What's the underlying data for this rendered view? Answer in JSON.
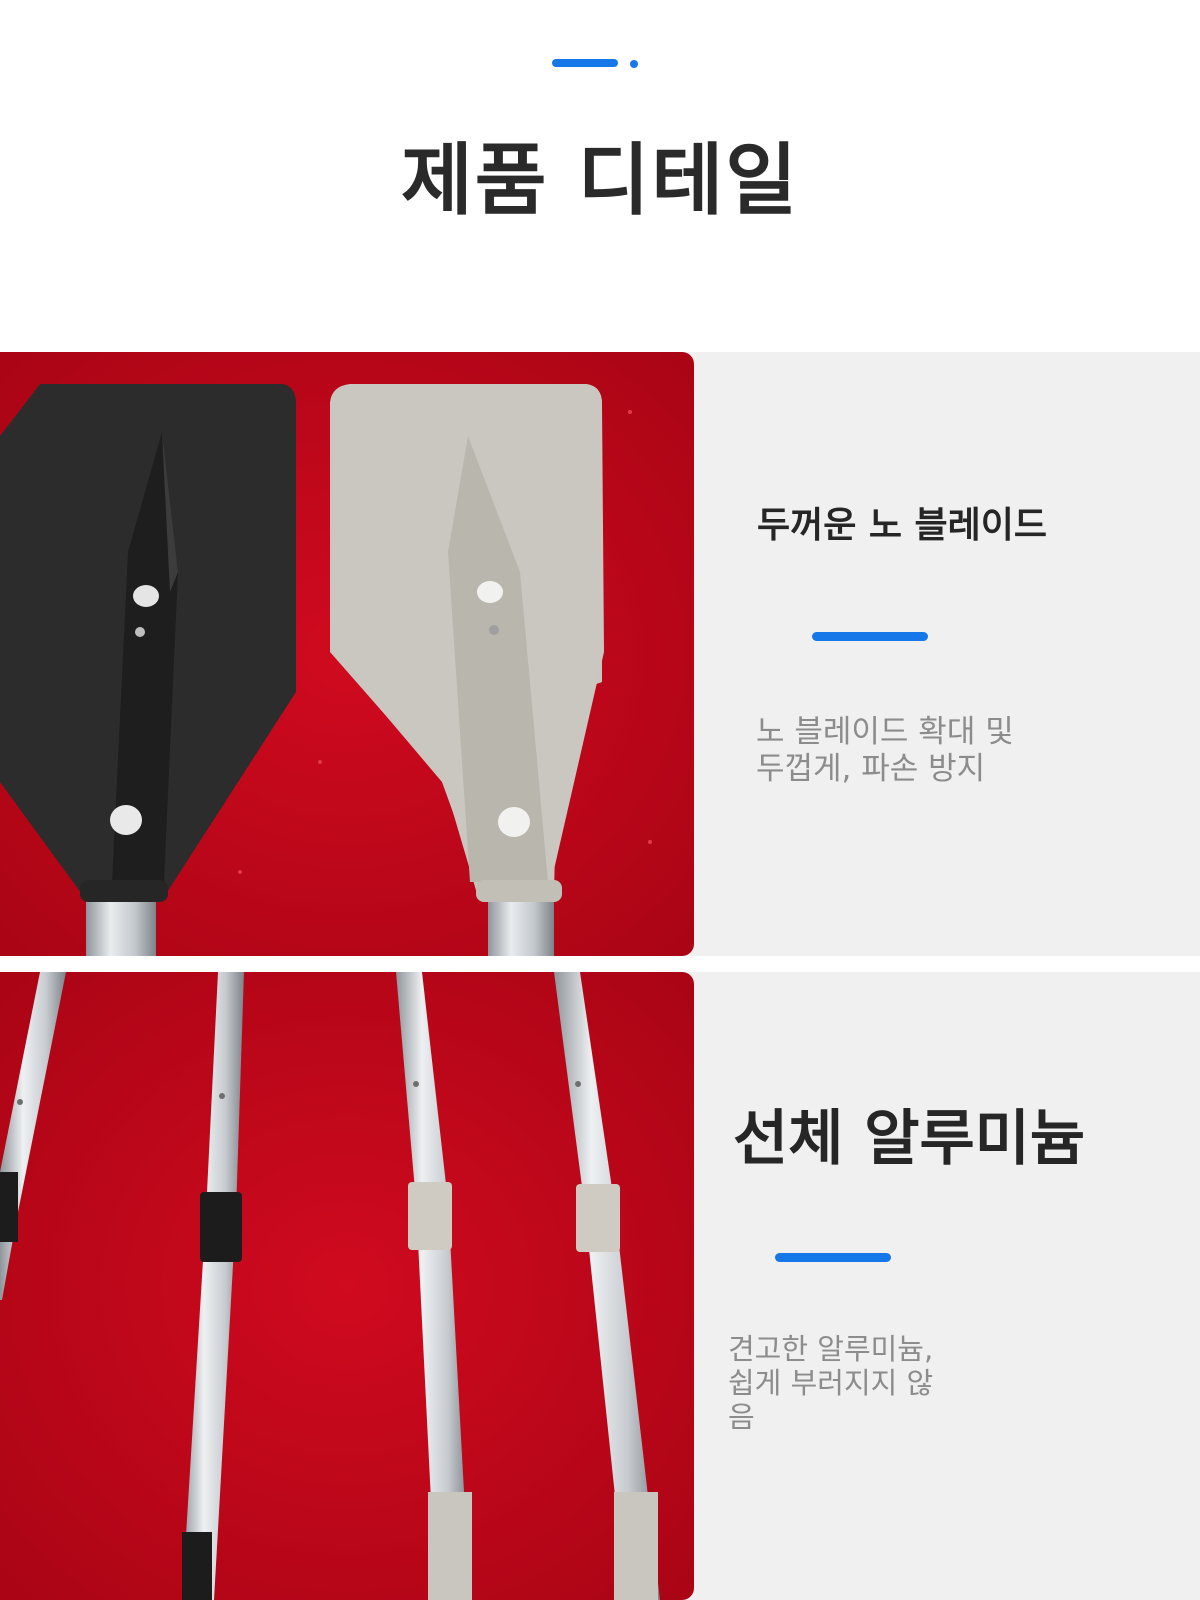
{
  "header": {
    "title": "제품 디테일",
    "accent_color": "#1677e8"
  },
  "features": [
    {
      "title": "두꺼운 노 블레이드",
      "description": "노 블레이드 확대 및\n 두껍게, 파손 방지",
      "photo": "oar-blade-closeup"
    },
    {
      "title": "선체 알루미늄",
      "description": "견고한 알루미늄,\n쉽게 부러지지 않\n음",
      "photo": "aluminum-shaft-closeup"
    }
  ],
  "colors": {
    "background": "#f0f0f0",
    "photo_backdrop": "#c2061a",
    "title_text": "#262626",
    "description_text": "#8c8c8c"
  }
}
